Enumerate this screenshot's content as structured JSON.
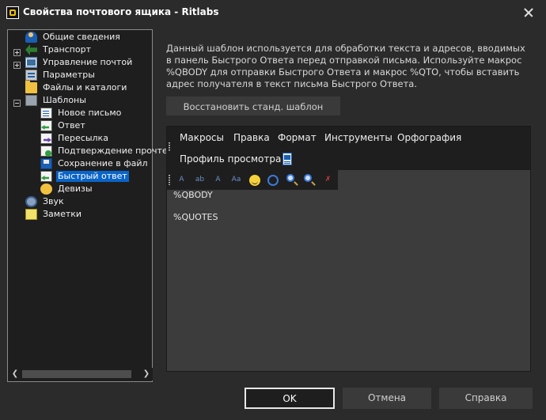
{
  "window": {
    "title": "Свойства почтового ящика - Ritlabs"
  },
  "tree": {
    "items": [
      {
        "label": "Общие сведения",
        "icon": "users-icon"
      },
      {
        "label": "Транспорт",
        "icon": "transport-icon"
      },
      {
        "label": "Управление почтой",
        "icon": "mail-management-icon"
      },
      {
        "label": "Параметры",
        "icon": "parameters-icon"
      },
      {
        "label": "Файлы и каталоги",
        "icon": "folder-icon"
      },
      {
        "label": "Шаблоны",
        "icon": "templates-icon"
      },
      {
        "label": "Новое письмо",
        "icon": "document-icon"
      },
      {
        "label": "Ответ",
        "icon": "reply-icon"
      },
      {
        "label": "Пересылка",
        "icon": "forward-icon"
      },
      {
        "label": "Подтверждение прочте",
        "icon": "confirmation-icon"
      },
      {
        "label": "Сохранение в файл",
        "icon": "save-icon"
      },
      {
        "label": "Быстрый ответ",
        "icon": "quick-reply-icon",
        "selected": true
      },
      {
        "label": "Девизы",
        "icon": "mottos-icon"
      },
      {
        "label": "Звук",
        "icon": "sound-icon"
      },
      {
        "label": "Заметки",
        "icon": "notes-icon"
      }
    ]
  },
  "description": "Данный шаблон используется для обработки текста и адресов, вводимых в панель Быстрого Ответа перед отправкой письма. Используйте макрос %QBODY для отправки Быстрого Ответа и макрос %QTO, чтобы вставить адрес получателя в текст письма Быстрого Ответа.",
  "restore_button": "Восстановить станд. шаблон",
  "editor": {
    "menu": [
      "Макросы",
      "Правка",
      "Формат",
      "Инструменты",
      "Орфография"
    ],
    "menu_row2": "Профиль просмотра",
    "content_lines": [
      "%QBODY",
      "%QUOTES"
    ]
  },
  "buttons": {
    "ok": "OK",
    "cancel": "Отмена",
    "apply": "Справка"
  }
}
